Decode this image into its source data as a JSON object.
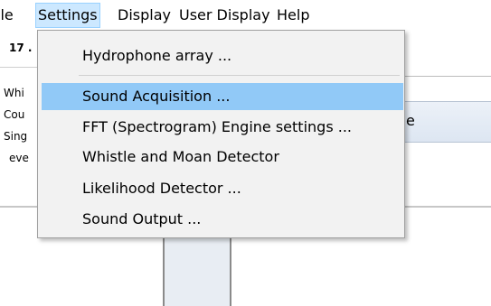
{
  "menubar": {
    "items": [
      {
        "label": "File",
        "shown": "ile"
      },
      {
        "label": "Settings"
      },
      {
        "label": "Display"
      },
      {
        "label": "User Display"
      },
      {
        "label": "Help"
      }
    ]
  },
  "left_panel": {
    "title": "17 .",
    "rows": [
      "Whi",
      "Cou",
      "Sing",
      "eve"
    ]
  },
  "header_fragment": "e",
  "settings_menu": {
    "items": [
      {
        "label": "Hydrophone array ..."
      },
      {
        "label": "Sound Acquisition ...",
        "highlighted": true
      },
      {
        "label": "FFT (Spectrogram) Engine settings ..."
      },
      {
        "label": "Whistle and Moan Detector"
      },
      {
        "label": "Likelihood Detector ..."
      },
      {
        "label": "Sound Output ..."
      }
    ]
  },
  "colors": {
    "menu_active": "#cce8ff",
    "item_highlight": "#91c9f7",
    "menu_background": "#f2f2f2"
  }
}
